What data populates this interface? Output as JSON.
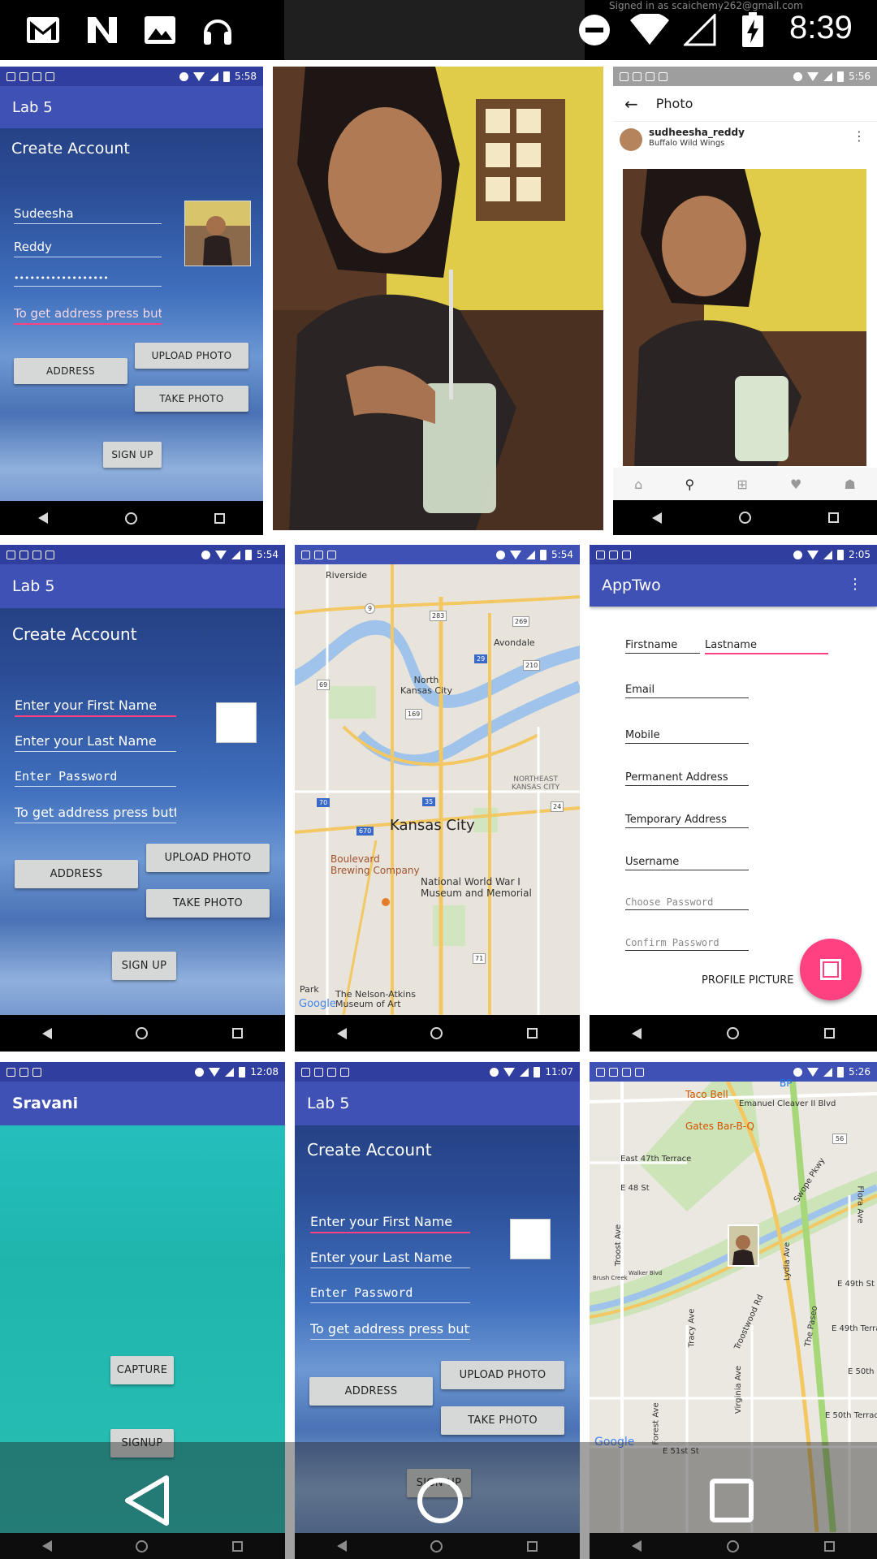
{
  "top_status": {
    "time": "8:39",
    "notification_text": "Signed in as scaichemy262@gmail.com"
  },
  "tile1": {
    "time": "5:58",
    "app_title": "Lab 5",
    "heading": "Create Account",
    "first_name": "Sudeesha",
    "last_name": "Reddy",
    "password_mask": "••••••••••••••••••",
    "address_field": "To get address press butt",
    "upload_btn": "UPLOAD PHOTO",
    "address_btn": "ADDRESS",
    "take_btn": "TAKE PHOTO",
    "signup_btn": "SIGN UP"
  },
  "tile3": {
    "time": "5:56",
    "title": "Photo",
    "username": "sudheesha_reddy",
    "location": "Buffalo Wild Wings"
  },
  "tile4": {
    "time": "5:54",
    "app_title": "Lab 5",
    "heading": "Create Account",
    "first_ph": "Enter your First Name",
    "last_ph": "Enter your Last Name",
    "pass_ph": "Enter Password",
    "address_field": "To get address press butt",
    "upload_btn": "UPLOAD PHOTO",
    "address_btn": "ADDRESS",
    "take_btn": "TAKE PHOTO",
    "signup_btn": "SIGN UP"
  },
  "tile5": {
    "time": "5:54",
    "labels": {
      "riverside": "Riverside",
      "avondale": "Avondale",
      "north_kc": "North\nKansas City",
      "ne_kc": "NORTHEAST\nKANSAS CITY",
      "kc": "Kansas City",
      "boulevard": "Boulevard\nBrewing Company",
      "museum": "National World War I\nMuseum and Memorial",
      "park": "Park",
      "nelson": "The Nelson-Atkins\nMuseum of Art",
      "google": "Google",
      "r9": "9",
      "r283": "283",
      "r269": "269",
      "r29": "29",
      "r210": "210",
      "r69": "69",
      "r169": "169",
      "r70": "70",
      "r35": "35",
      "r24": "24",
      "r670": "670",
      "r71": "71"
    }
  },
  "tile6": {
    "time": "2:05",
    "app_title": "AppTwo",
    "firstname": "Firstname",
    "lastname": "Lastname",
    "email": "Email",
    "mobile": "Mobile",
    "perm_addr": "Permanent Address",
    "temp_addr": "Temporary Address",
    "username": "Username",
    "choose_pw": "Choose Password",
    "confirm_pw": "Confirm Password",
    "profile_pic": "PROFILE PICTURE"
  },
  "tile7": {
    "time": "12:08",
    "app_title": "Sravani",
    "capture_btn": "CAPTURE",
    "signup_btn": "SIGNUP"
  },
  "tile8": {
    "time": "11:07",
    "app_title": "Lab 5",
    "heading": "Create Account",
    "first_ph": "Enter your First Name",
    "last_ph": "Enter your Last Name",
    "pass_ph": "Enter Password",
    "address_field": "To get address press butt",
    "upload_btn": "UPLOAD PHOTO",
    "address_btn": "ADDRESS",
    "take_btn": "TAKE PHOTO",
    "signup_btn": "SIGN UP"
  },
  "tile9": {
    "time": "5:26",
    "labels": {
      "bp": "BP",
      "taco": "Taco Bell",
      "emanuel": "Emanuel Cleaver II Blvd",
      "gates": "Gates Bar-B-Q",
      "e47": "East 47th Terrace",
      "e48": "E 48 St",
      "swope": "Swope Pkwy",
      "flora": "Flora Ave",
      "troost": "Troost Ave",
      "brush": "Brush Creek",
      "walker": "Walker Blvd",
      "tracy": "Tracy Ave",
      "troostwood": "Troostwood Rd",
      "lydia": "Lydia Ave",
      "paseo": "The Paseo",
      "e49": "E 49th St",
      "e49t": "E 49th Terrace",
      "e50": "E 50th",
      "e50t": "E 50th Terrace",
      "virginia": "Virginia Ave",
      "forest": "Forest Ave",
      "e51": "E 51st St",
      "google": "Google",
      "r56": "56"
    }
  }
}
